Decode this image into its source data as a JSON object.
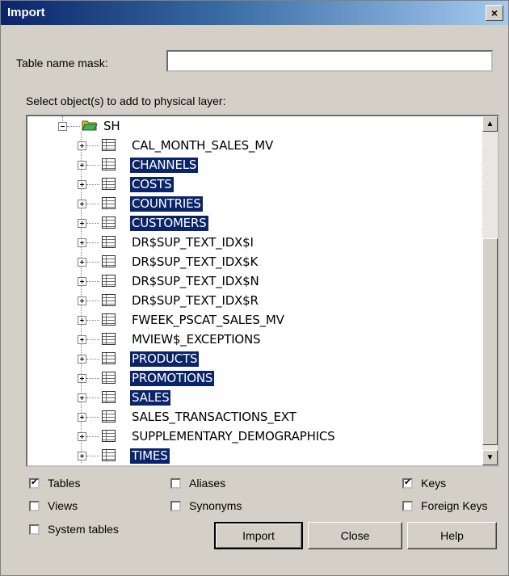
{
  "window": {
    "title": "Import",
    "close_glyph": "×"
  },
  "form": {
    "mask_label": "Table name mask:",
    "mask_value": "",
    "select_label": "Select object(s) to add to physical layer:"
  },
  "tree": {
    "root": {
      "label": "SH",
      "icon": "folder-open-icon"
    },
    "items": [
      {
        "label": "CAL_MONTH_SALES_MV",
        "selected": false
      },
      {
        "label": "CHANNELS",
        "selected": true
      },
      {
        "label": "COSTS",
        "selected": true
      },
      {
        "label": "COUNTRIES",
        "selected": true
      },
      {
        "label": "CUSTOMERS",
        "selected": true
      },
      {
        "label": "DR$SUP_TEXT_IDX$I",
        "selected": false
      },
      {
        "label": "DR$SUP_TEXT_IDX$K",
        "selected": false
      },
      {
        "label": "DR$SUP_TEXT_IDX$N",
        "selected": false
      },
      {
        "label": "DR$SUP_TEXT_IDX$R",
        "selected": false
      },
      {
        "label": "FWEEK_PSCAT_SALES_MV",
        "selected": false
      },
      {
        "label": "MVIEW$_EXCEPTIONS",
        "selected": false
      },
      {
        "label": "PRODUCTS",
        "selected": true
      },
      {
        "label": "PROMOTIONS",
        "selected": true
      },
      {
        "label": "SALES",
        "selected": true
      },
      {
        "label": "SALES_TRANSACTIONS_EXT",
        "selected": false
      },
      {
        "label": "SUPPLEMENTARY_DEMOGRAPHICS",
        "selected": false
      },
      {
        "label": "TIMES",
        "selected": true
      }
    ]
  },
  "options": {
    "tables": {
      "label": "Tables",
      "checked": true
    },
    "views": {
      "label": "Views",
      "checked": false
    },
    "system_tables": {
      "label": "System tables",
      "checked": false
    },
    "aliases": {
      "label": "Aliases",
      "checked": false
    },
    "synonyms": {
      "label": "Synonyms",
      "checked": false
    },
    "keys": {
      "label": "Keys",
      "checked": true
    },
    "foreign_keys": {
      "label": "Foreign Keys",
      "checked": false
    }
  },
  "buttons": {
    "import": "Import",
    "close": "Close",
    "help": "Help"
  },
  "colors": {
    "selection": "#0a246a",
    "title_start": "#0a246a",
    "title_end": "#a6caf0",
    "face": "#d4d0c8"
  }
}
